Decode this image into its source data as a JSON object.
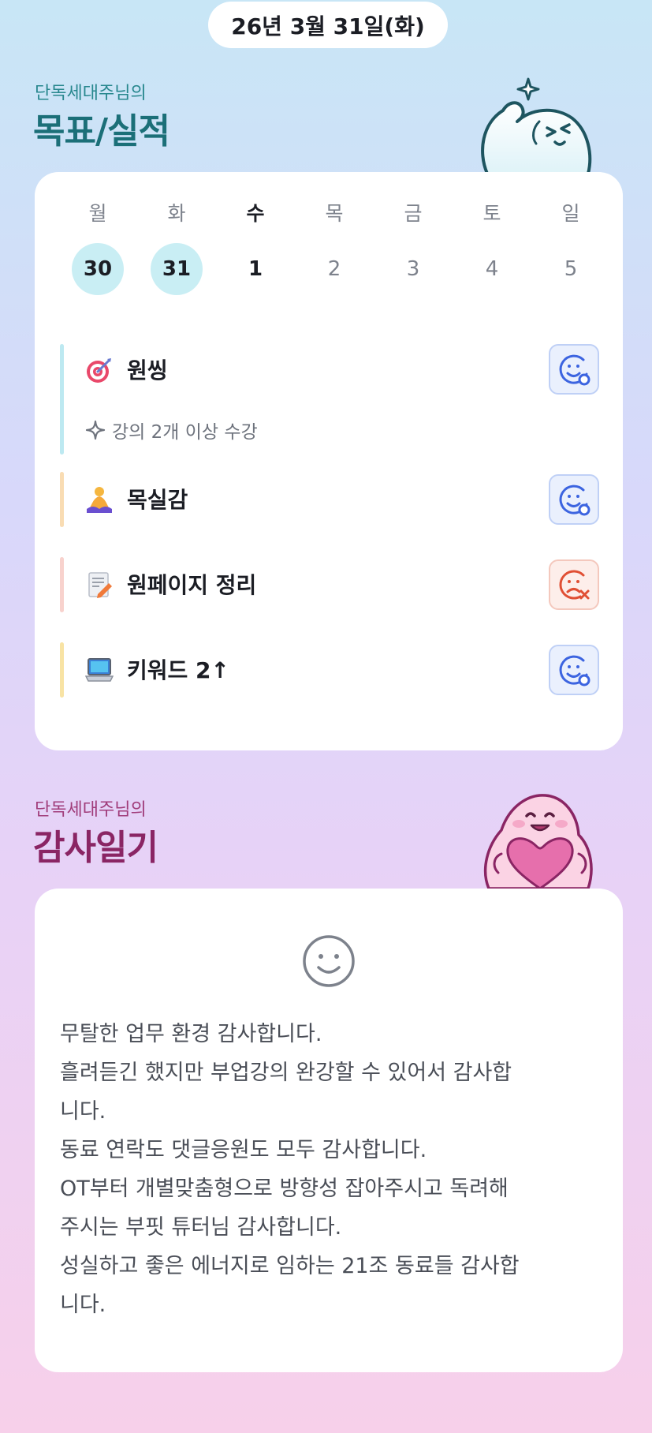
{
  "header": {
    "date": "26년 3월 31일(화)"
  },
  "goals_section": {
    "subtitle": "단독세대주님의",
    "title": "목표/실적"
  },
  "week": {
    "days": [
      {
        "weekday": "월",
        "date": "30",
        "state": "past"
      },
      {
        "weekday": "화",
        "date": "31",
        "state": "past"
      },
      {
        "weekday": "수",
        "date": "1",
        "state": "today"
      },
      {
        "weekday": "목",
        "date": "2",
        "state": "future"
      },
      {
        "weekday": "금",
        "date": "3",
        "state": "future"
      },
      {
        "weekday": "토",
        "date": "4",
        "state": "future"
      },
      {
        "weekday": "일",
        "date": "5",
        "state": "future"
      }
    ]
  },
  "goals": [
    {
      "icon": "target-icon",
      "label": "원씽",
      "detail": "강의 2개 이상 수강",
      "status": "achieved",
      "bar_color": "#bde9f1"
    },
    {
      "icon": "meditation-icon",
      "label": "목실감",
      "status": "achieved",
      "bar_color": "#f9dcb3"
    },
    {
      "icon": "memo-icon",
      "label": "원페이지 정리",
      "status": "missed",
      "bar_color": "#f8d2cd"
    },
    {
      "icon": "laptop-icon",
      "label": "키워드 2↑",
      "status": "achieved",
      "bar_color": "#f8e3a4"
    }
  ],
  "diary_section": {
    "subtitle": "단독세대주님의",
    "title": "감사일기",
    "mood_icon": "smile-face-icon",
    "lines": [
      "무탈한 업무 환경 감사합니다.",
      "흘려듣긴 했지만 부업강의 완강할 수 있어서 감사합",
      "니다.",
      "동료 연락도 댓글응원도 모두 감사합니다.",
      "OT부터 개별맞춤형으로 방향성 잡아주시고 독려해",
      "주시는 부핏 튜터님 감사합니다.",
      "성실하고 좋은 에너지로 임하는 21조 동료들 감사합",
      "니다."
    ]
  },
  "colors": {
    "goal_title": "#1b6f78",
    "diary_title": "#8a2564",
    "achieved": "#3c64e0",
    "missed": "#e04f34"
  }
}
